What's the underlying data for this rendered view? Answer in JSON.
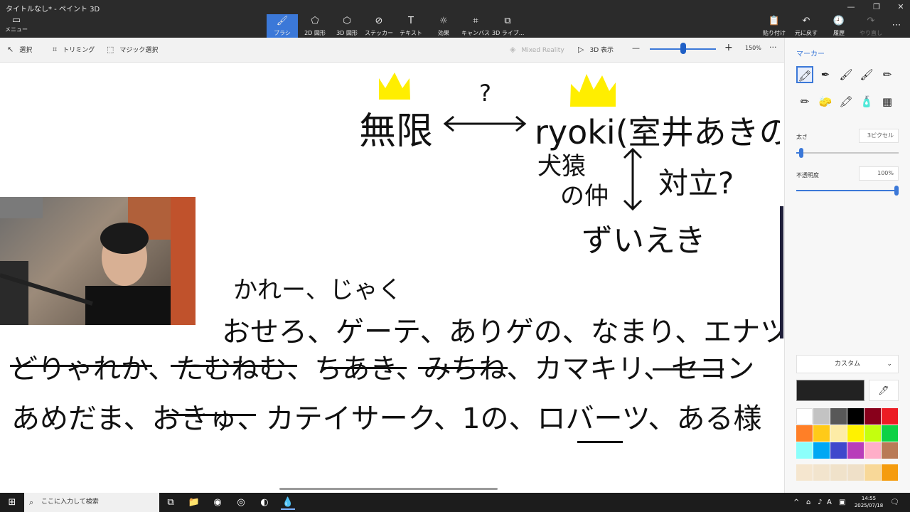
{
  "window": {
    "title": "タイトルなし* - ペイント 3D",
    "controls": {
      "minimize": "—",
      "maximize": "❐",
      "close": "✕"
    }
  },
  "menu": {
    "label": "メニュー",
    "icon": "folder-icon"
  },
  "tools": [
    {
      "label": "ブラシ",
      "glyph": "🖌",
      "icon": "brush-icon",
      "active": true
    },
    {
      "label": "2D 図形",
      "glyph": "⬠",
      "icon": "shapes-2d-icon"
    },
    {
      "label": "3D 図形",
      "glyph": "⬡",
      "icon": "shapes-3d-icon"
    },
    {
      "label": "ステッカー",
      "glyph": "⊘",
      "icon": "sticker-icon"
    },
    {
      "label": "テキスト",
      "glyph": "T",
      "icon": "text-icon"
    },
    {
      "label": "効果",
      "glyph": "☼",
      "icon": "effects-icon"
    },
    {
      "label": "キャンバス",
      "glyph": "⌗",
      "icon": "canvas-icon"
    },
    {
      "label": "3D ライブ...",
      "glyph": "⧉",
      "icon": "library-3d-icon"
    }
  ],
  "actions": [
    {
      "label": "貼り付け",
      "glyph": "📋",
      "icon": "paste-icon"
    },
    {
      "label": "元に戻す",
      "glyph": "↶",
      "icon": "undo-icon"
    },
    {
      "label": "履歴",
      "glyph": "🕘",
      "icon": "history-icon"
    },
    {
      "label": "やり直し",
      "glyph": "↷",
      "icon": "redo-icon",
      "disabled": true
    }
  ],
  "more_glyph": "⋯",
  "subtoolbar": {
    "select": "選択",
    "trim": "トリミング",
    "magic_select": "マジック選択",
    "mixed_reality": "Mixed Reality",
    "view_3d": "3D 表示",
    "zoom_minus": "—",
    "zoom_plus": "+",
    "zoom_level": "150%",
    "more": "···"
  },
  "canvas": {
    "lines": [
      {
        "text": "無限",
        "color": "#111111"
      },
      {
        "text": "?",
        "color": "#111111"
      },
      {
        "text": "ryoki(室井あきのり)",
        "color": "#111111"
      },
      {
        "text": "犬猿",
        "color": "#111111"
      },
      {
        "text": "の仲",
        "color": "#111111"
      },
      {
        "text": "対立?",
        "color": "#111111"
      },
      {
        "text": "ずいえき",
        "color": "#111111"
      },
      {
        "text": "かれー、じゃく",
        "color": "#111111"
      },
      {
        "text": "おせろ、ゲーテ、ありゲの、なまり、エナツ",
        "color": "#111111"
      },
      {
        "text": "どりゃれか、たむねむ、ちあき、みちね、カマキリ、セコン",
        "color": "#111111"
      },
      {
        "text": "あめだま、おきゅ、カテイサーク、1の、ロバーツ、ある様",
        "color": "#111111"
      }
    ],
    "crown_color": "#ffee00",
    "ink_color": "#111111"
  },
  "panel": {
    "title": "マーカー",
    "brushes": [
      {
        "glyph": "🖍",
        "icon": "marker-icon",
        "active": true
      },
      {
        "glyph": "✒",
        "icon": "calligraphy-pen-icon"
      },
      {
        "glyph": "🖌",
        "icon": "oil-brush-icon"
      },
      {
        "glyph": "🖌",
        "icon": "watercolor-icon"
      },
      {
        "glyph": "✏",
        "icon": "pixel-pen-icon"
      },
      {
        "glyph": "✏",
        "icon": "pencil-icon"
      },
      {
        "glyph": "🧽",
        "icon": "eraser-icon"
      },
      {
        "glyph": "🖍",
        "icon": "crayon-icon"
      },
      {
        "glyph": "🧴",
        "icon": "spray-can-icon"
      },
      {
        "glyph": "▦",
        "icon": "fill-icon"
      }
    ],
    "thickness_label": "太さ",
    "thickness_value": "3ピクセル",
    "thickness_level": 0.03,
    "opacity_label": "不透明度",
    "opacity_value": "100%",
    "opacity_level": 1.0,
    "color_dropdown": "カスタム",
    "chevron": "⌄",
    "current_color": "#222222",
    "eyedropper_glyph": "🖊",
    "palette": [
      "#ffffff",
      "#c3c3c3",
      "#585858",
      "#000000",
      "#88001b",
      "#ec1c24",
      "#ff7f27",
      "#ffca18",
      "#fdeca6",
      "#fff200",
      "#c4ff0e",
      "#0ed145",
      "#8cfffb",
      "#00a8f3",
      "#3f48cc",
      "#b83dba",
      "#ffaec8",
      "#b97a56"
    ],
    "custom_palette": [
      "#f5e6cf",
      "#f2e4cd",
      "#f0e2ca",
      "#efe0c8",
      "#f8d898",
      "#f59c0e"
    ]
  },
  "taskbar": {
    "start_glyph": "⊞",
    "search_placeholder": "ここに入力して検索",
    "search_glyph": "⌕",
    "apps": [
      {
        "glyph": "⧉",
        "icon": "task-view-icon"
      },
      {
        "glyph": "📁",
        "icon": "file-explorer-icon"
      },
      {
        "glyph": "◉",
        "icon": "chrome-icon"
      },
      {
        "glyph": "◎",
        "icon": "obs-icon"
      },
      {
        "glyph": "◐",
        "icon": "orange-app-icon"
      },
      {
        "glyph": "💧",
        "icon": "paint-3d-icon",
        "active": true
      }
    ],
    "tray_up": "^",
    "tray_ime": "A",
    "clock_time": "14:55",
    "clock_date": "2025/07/18",
    "notify_glyph": "🗨"
  }
}
